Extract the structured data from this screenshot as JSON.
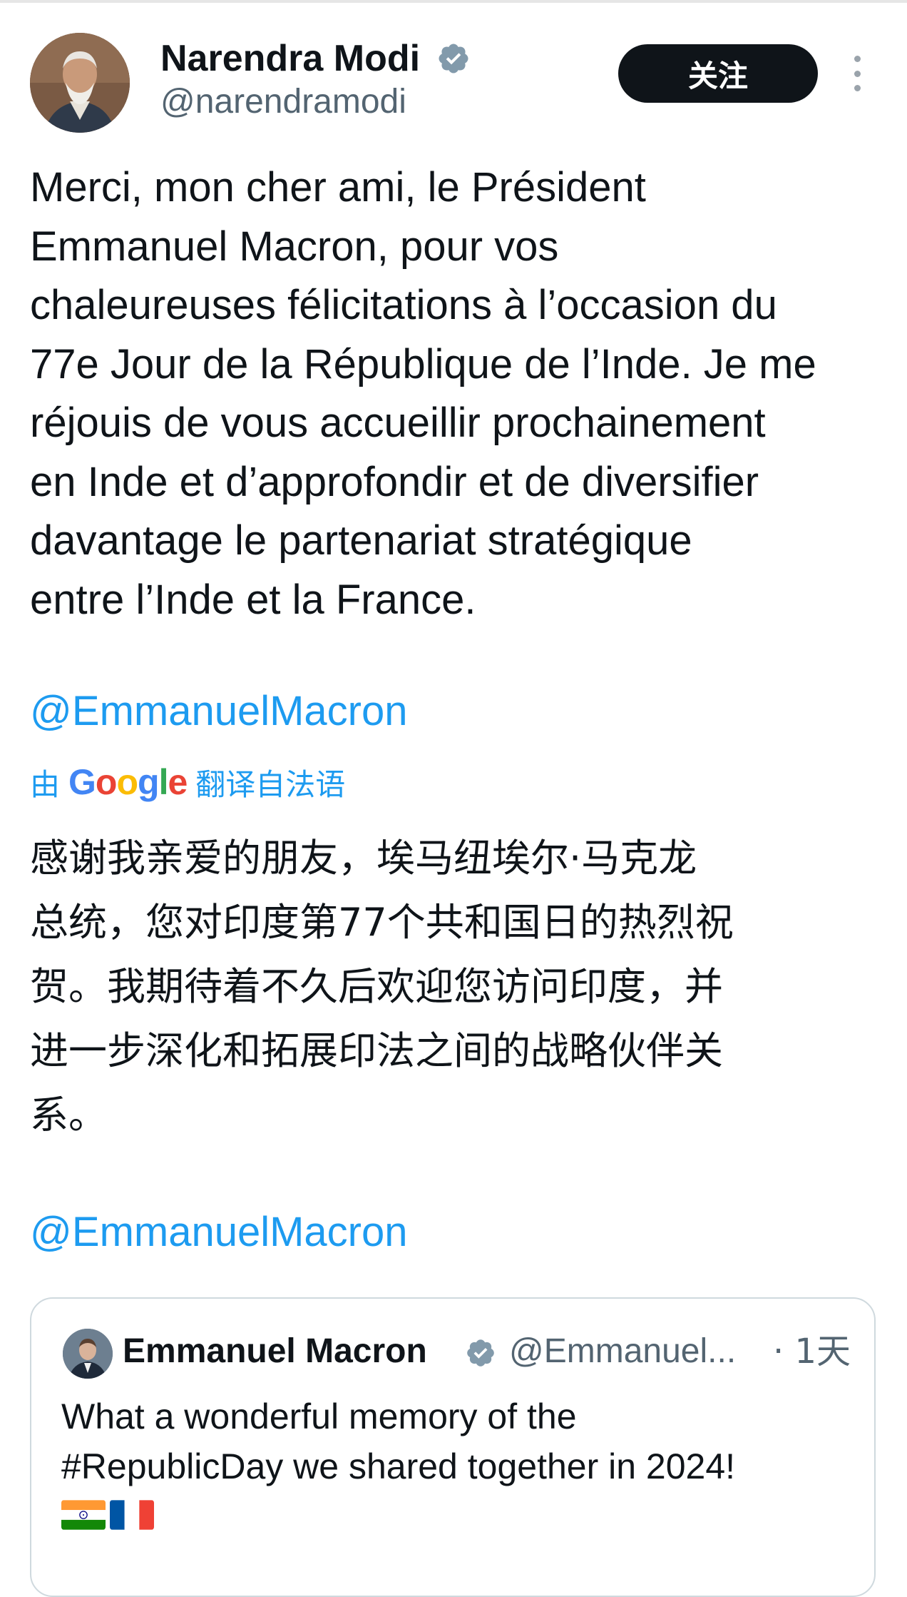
{
  "tweet": {
    "author_name": "Narendra Modi",
    "author_handle": "@narendramodi",
    "follow_label": "关注",
    "text_lines": [
      "Merci, mon cher ami, le Président",
      "Emmanuel Macron, pour vos",
      "chaleureuses félicitations à l’occasion du",
      "77e Jour de la République de l’Inde. Je me",
      "réjouis de vous accueillir prochainement",
      "en Inde et d’approfondir et de diversifier",
      "davantage le partenariat stratégique",
      "entre l’Inde et la France."
    ],
    "mention": "@EmmanuelMacron",
    "translation": {
      "prefix": "由",
      "provider": "Google",
      "suffix": "翻译自法语",
      "text_lines": [
        "感谢我亲爱的朋友，埃马纽埃尔·马克龙",
        "总统，您对印度第77个共和国日的热烈祝",
        "贺。我期待着不久后欢迎您访问印度，并",
        "进一步深化和拓展印法之间的战略伙伴关",
        "系。"
      ],
      "mention": "@EmmanuelMacron"
    }
  },
  "quoted_tweet": {
    "author_name": "Emmanuel Macron",
    "author_handle": "@Emmanuel...",
    "time": "· 1天",
    "text_lines": [
      "What a wonderful memory of the",
      "#RepublicDay we shared together in 2024!"
    ],
    "flags": [
      "india-flag",
      "france-flag"
    ]
  },
  "colors": {
    "text": "#0f1419",
    "secondary": "#536471",
    "link": "#1d9bf0",
    "button_bg": "#0f1419",
    "verified": "#829aab"
  }
}
